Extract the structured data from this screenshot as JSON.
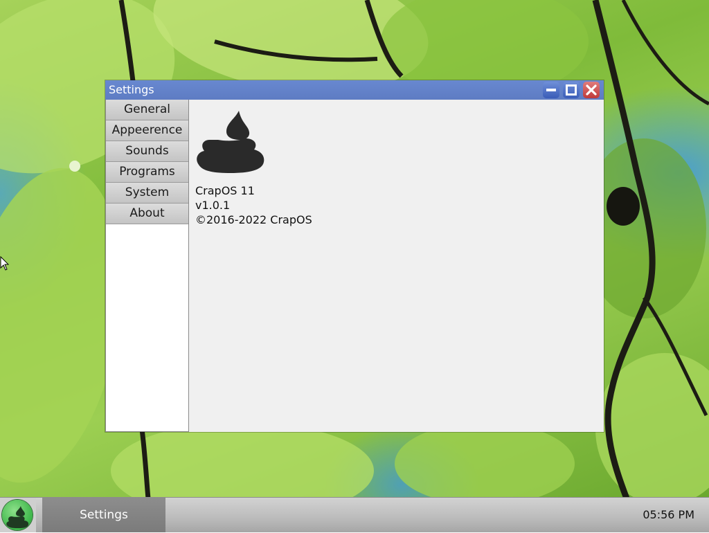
{
  "window": {
    "title": "Settings",
    "controls": {
      "minimize": "minimize-icon",
      "maximize": "maximize-icon",
      "close": "close-icon"
    }
  },
  "sidebar": {
    "items": [
      {
        "label": "General"
      },
      {
        "label": "Appeerence"
      },
      {
        "label": "Sounds"
      },
      {
        "label": "Programs"
      },
      {
        "label": "System"
      },
      {
        "label": "About"
      }
    ]
  },
  "about": {
    "logo_icon": "crapos-logo-icon",
    "product": "CrapOS 11",
    "version": "v1.0.1",
    "copyright": "©2016-2022 CrapOS"
  },
  "taskbar": {
    "start_icon": "crapos-logo-icon",
    "tasks": [
      {
        "label": "Settings"
      }
    ],
    "clock": "05:56 PM"
  },
  "colors": {
    "titlebar": "#3a5cb8",
    "close_button": "#c03a3a",
    "start_button": "#3bb548",
    "content_bg": "#f0f0f0"
  }
}
